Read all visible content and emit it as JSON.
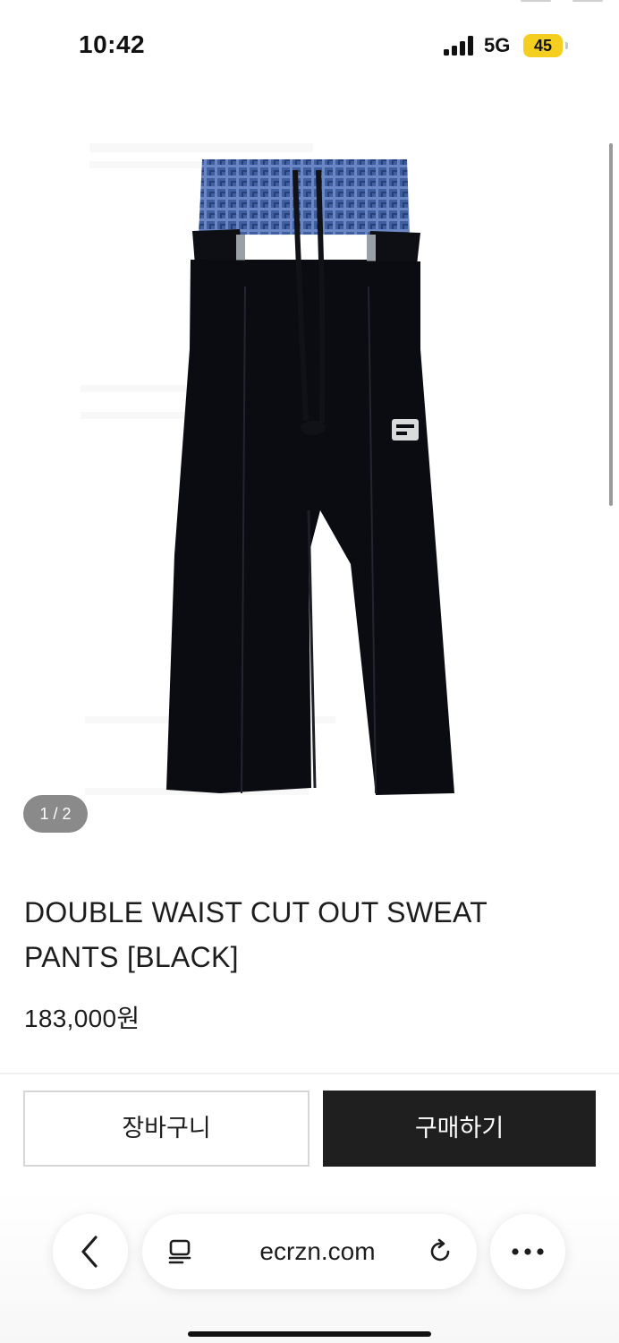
{
  "status_bar": {
    "time": "10:42",
    "network": "5G",
    "battery": "45",
    "battery_color": "#f5cf1f"
  },
  "gallery": {
    "counter": "1 / 2",
    "image_description_icon": "product-photo"
  },
  "product": {
    "title": "DOUBLE WAIST CUT OUT SWEAT PANTS [BLACK]",
    "price": "183,000원"
  },
  "actions": {
    "cart_label": "장바구니",
    "buy_label": "구매하기",
    "buy_color": "#1f1f1f"
  },
  "browser": {
    "url": "ecrzn.com",
    "back_icon": "chevron-left-icon",
    "reader_icon": "reader-icon",
    "reload_icon": "reload-icon",
    "more_icon": "more-icon"
  }
}
